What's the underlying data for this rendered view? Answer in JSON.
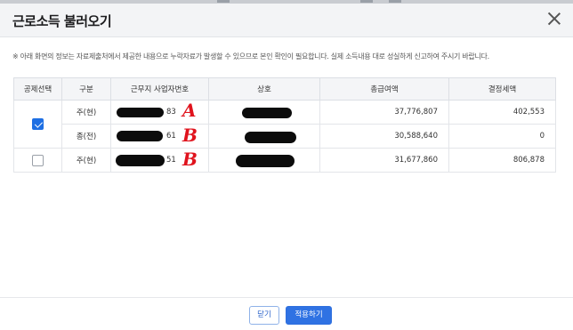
{
  "dialog": {
    "title": "근로소득 불러오기",
    "notice": "※ 아래 화면의 정보는 자료제출처에서 제공한 내용으로 누락자료가 발생할 수 있으므로 본인 확인이 필요합니다. 실제 소득내용 대로 성실하게 신고하여 주시기 바랍니다."
  },
  "table": {
    "headers": [
      "공제선택",
      "구분",
      "근무지 사업자번호",
      "상호",
      "총급여액",
      "결정세액"
    ],
    "rows": [
      {
        "type": "주(현)",
        "id_suffix": "83",
        "name": "",
        "gross": "37,776,807",
        "tax": "402,553",
        "mark": "A"
      },
      {
        "type": "종(전)",
        "id_suffix": "61",
        "name": "",
        "gross": "30,588,640",
        "tax": "0",
        "mark": "B"
      },
      {
        "type": "주(현)",
        "id_suffix": "51",
        "name": "",
        "gross": "31,677,860",
        "tax": "806,878",
        "mark": "B"
      }
    ],
    "selection": [
      {
        "checked": true,
        "rows": [
          0,
          1
        ]
      },
      {
        "checked": false,
        "rows": [
          2
        ]
      }
    ]
  },
  "buttons": {
    "close_label": "닫기",
    "apply_label": "적용하기"
  },
  "colors": {
    "accent": "#2f72e3",
    "annotation": "#e0131d",
    "header_bg": "#f3f4f6"
  }
}
